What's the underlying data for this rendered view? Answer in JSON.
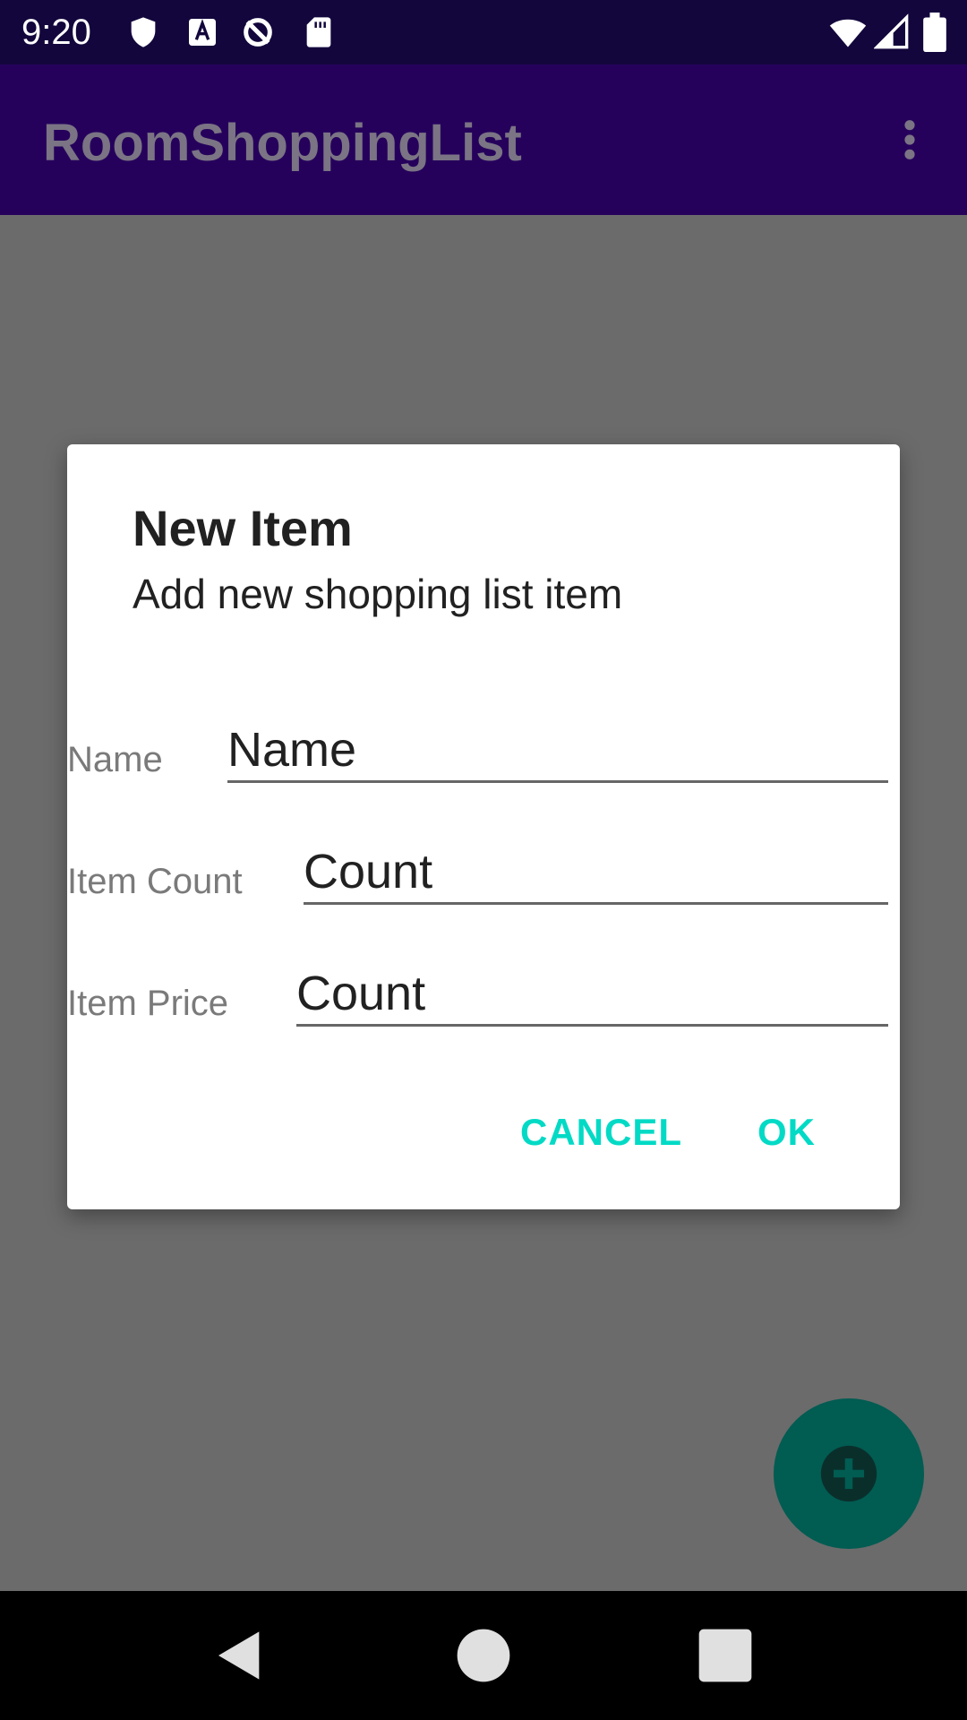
{
  "status_bar": {
    "time": "9:20",
    "left_icons": [
      "shield-icon",
      "keyboard-a-icon",
      "no-sync-icon",
      "sd-card-icon"
    ],
    "right_icons": [
      "wifi-icon",
      "signal-icon",
      "battery-icon"
    ]
  },
  "app_bar": {
    "title": "RoomShoppingList",
    "menu_icon": "overflow-menu-icon"
  },
  "dialog": {
    "title": "New Item",
    "subtitle": "Add new shopping list item",
    "fields": {
      "name": {
        "label": "Name",
        "placeholder": "Name"
      },
      "count": {
        "label": "Item Count",
        "placeholder": "Count"
      },
      "price": {
        "label": "Item Price",
        "placeholder": "Count"
      }
    },
    "buttons": {
      "cancel": "CANCEL",
      "ok": "OK"
    }
  },
  "fab": {
    "icon": "add-icon"
  },
  "nav_bar": {
    "icons": [
      "back-icon",
      "home-icon",
      "recents-icon"
    ]
  },
  "colors": {
    "status_bar": "#13063c",
    "app_bar": "#26015c",
    "scrim_background": "#6b6b6b",
    "accent": "#03dac5",
    "fab": "#015c52"
  }
}
